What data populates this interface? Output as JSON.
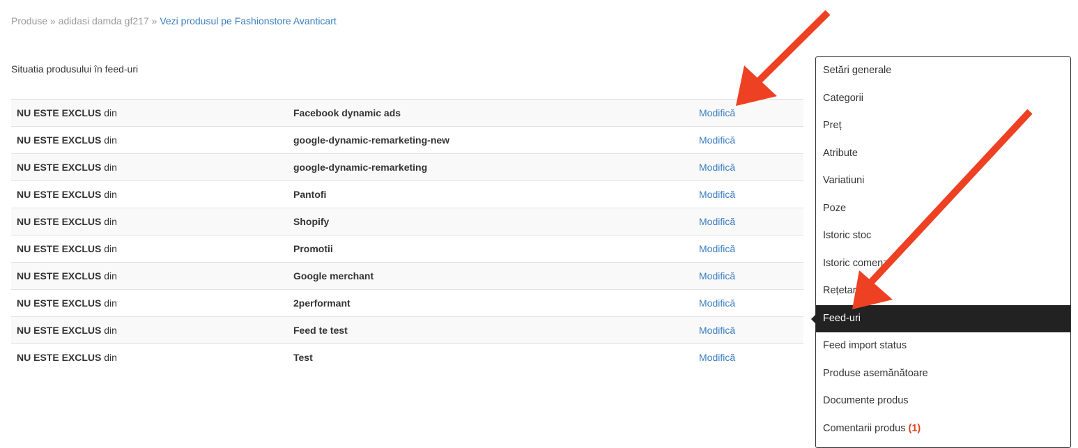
{
  "breadcrumb": {
    "items": [
      "Produse",
      "adidasi damda gf217"
    ],
    "separator": "»",
    "link": "Vezi produsul pe Fashionstore Avanticart"
  },
  "section": {
    "title": "Situatia produsului în feed-uri"
  },
  "feeds": {
    "status_bold": "NU ESTE EXCLUS",
    "status_suffix": "din",
    "action_label": "Modifică",
    "rows": [
      {
        "name": "Facebook dynamic ads"
      },
      {
        "name": "google-dynamic-remarketing-new"
      },
      {
        "name": "google-dynamic-remarketing"
      },
      {
        "name": "Pantofi"
      },
      {
        "name": "Shopify"
      },
      {
        "name": "Promotii"
      },
      {
        "name": "Google merchant"
      },
      {
        "name": "2performant"
      },
      {
        "name": "Feed te test"
      },
      {
        "name": "Test"
      }
    ]
  },
  "sidebar": {
    "items": [
      {
        "label": "Setări generale"
      },
      {
        "label": "Categorii"
      },
      {
        "label": "Preț"
      },
      {
        "label": "Atribute"
      },
      {
        "label": "Variatiuni"
      },
      {
        "label": "Poze"
      },
      {
        "label": "Istoric stoc"
      },
      {
        "label": "Istoric comenzi"
      },
      {
        "label": "Rețetar"
      },
      {
        "label": "Feed-uri",
        "active": true
      },
      {
        "label": "Feed import status"
      },
      {
        "label": "Produse asemănătoare"
      },
      {
        "label": "Documente produs"
      },
      {
        "label": "Comentarii produs",
        "badge": "(1)"
      }
    ]
  },
  "colors": {
    "link": "#3a7dc0",
    "active_bg": "#222222",
    "arrow": "#ee4022",
    "badge": "#e0421b"
  }
}
